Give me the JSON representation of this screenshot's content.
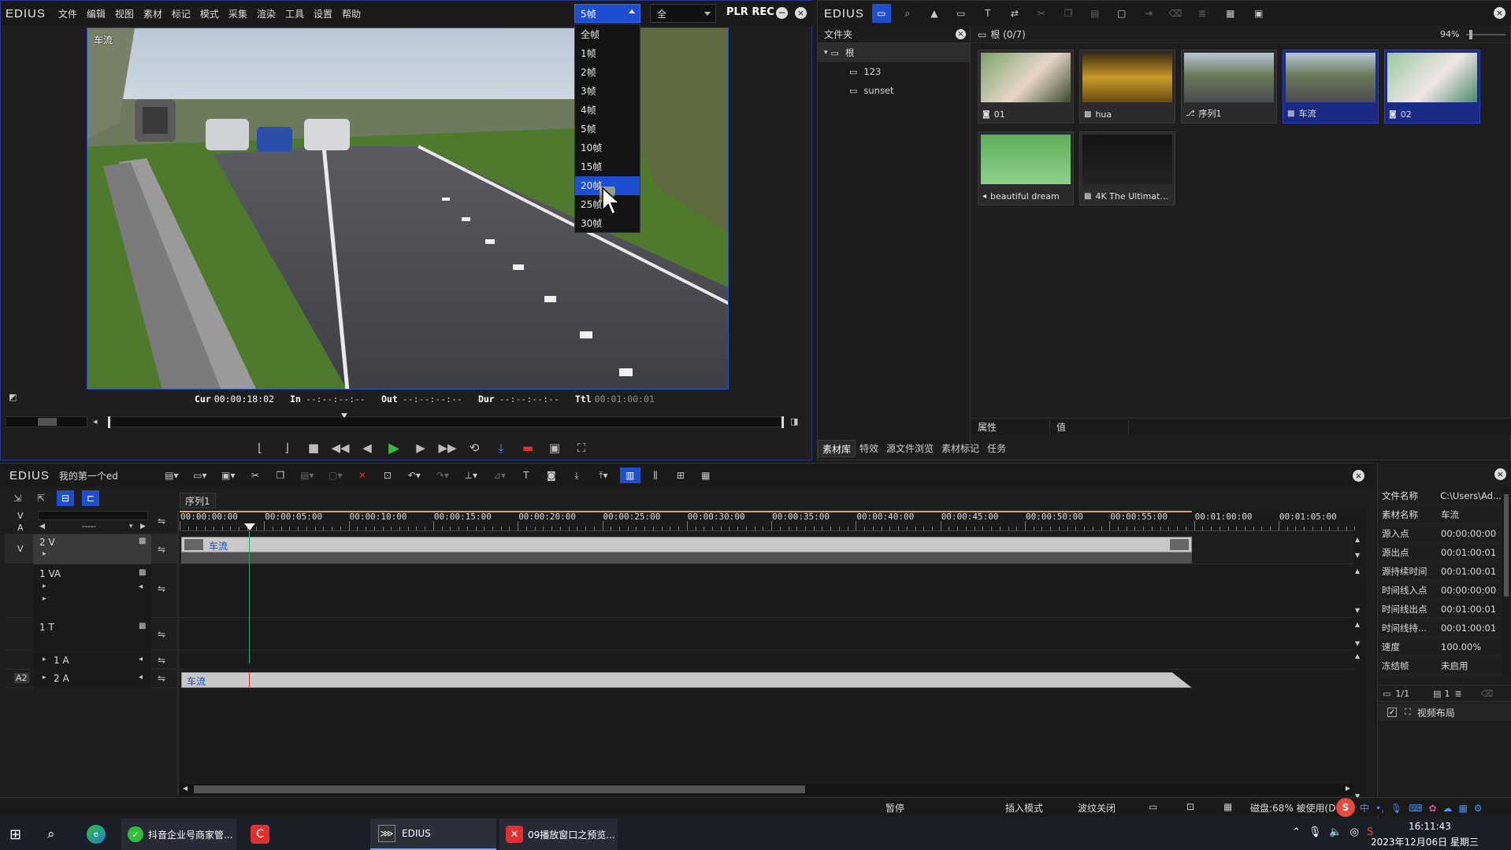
{
  "player": {
    "logo": "EDIUS",
    "menu": [
      "文件",
      "编辑",
      "视图",
      "素材",
      "标记",
      "模式",
      "采集",
      "渲染",
      "工具",
      "设置",
      "帮助"
    ],
    "step_select": "5帧",
    "quality_select": "全",
    "plr_rec": "PLR REC",
    "overlay_label": "车流",
    "dropdown_items": [
      "全帧",
      "1帧",
      "2帧",
      "3帧",
      "4帧",
      "5帧",
      "10帧",
      "15帧",
      "20帧",
      "25帧",
      "30帧"
    ],
    "dropdown_highlight_index": 8,
    "cur_label": "Cur",
    "cur_value": "00:00:18:02",
    "in_label": "In",
    "in_value": "--:--:--:--",
    "out_label": "Out",
    "out_value": "--:--:--:--",
    "dur_label": "Dur",
    "dur_value": "--:--:--:--",
    "ttl_label": "Ttl",
    "ttl_value": "00:01:00:01",
    "scrub_position": 0.35
  },
  "bin": {
    "logo": "EDIUS",
    "folder_header": "文件夹",
    "tree": [
      {
        "label": "根",
        "level": 0
      },
      {
        "label": "123",
        "level": 1
      },
      {
        "label": "sunset",
        "level": 1
      }
    ],
    "path": "根 (0/7)",
    "zoom": "94%",
    "clips": [
      {
        "label": "01",
        "kind": "image",
        "selected": false
      },
      {
        "label": "hua",
        "kind": "video",
        "selected": false
      },
      {
        "label": "序列1",
        "kind": "sequence",
        "selected": false
      },
      {
        "label": "车流",
        "kind": "video",
        "selected": true
      },
      {
        "label": "02",
        "kind": "image",
        "selected": true
      },
      {
        "label": "beautiful dream",
        "kind": "audio",
        "selected": false
      },
      {
        "label": "4K The Ultimat...",
        "kind": "video",
        "selected": false
      }
    ],
    "prop_col": "属性",
    "val_col": "值",
    "tabs": [
      "素材库",
      "特效",
      "源文件浏览",
      "素材标记",
      "任务"
    ]
  },
  "timeline": {
    "logo": "EDIUS",
    "project": "我的第一个ed",
    "sequence_tab": "序列1",
    "ruler": [
      "00:00:00:00",
      "00:00:05:00",
      "00:00:10:00",
      "00:00:15:00",
      "00:00:20:00",
      "00:00:25:00",
      "00:00:30:00",
      "00:00:35:00",
      "00:00:40:00",
      "00:00:45:00",
      "00:00:50:00",
      "00:00:55:00",
      "00:01:00:00",
      "00:01:05:00"
    ],
    "va_header_v": "V",
    "va_header_a": "A",
    "va_dash": "-----",
    "tracks": {
      "t2v": {
        "side": "V",
        "name": "2 V"
      },
      "t1va": {
        "name": "1 VA"
      },
      "t1t": {
        "name": "1 T"
      },
      "t1a": {
        "name": "1 A"
      },
      "t2a": {
        "side": "A2",
        "name": "2 A"
      }
    },
    "clip_video": "车流",
    "clip_audio": "车流"
  },
  "info": {
    "rows": [
      {
        "k": "文件名称",
        "v": "C:\\Users\\Ad..."
      },
      {
        "k": "素材名称",
        "v": "车流"
      },
      {
        "k": "源入点",
        "v": "00:00:00:00"
      },
      {
        "k": "源出点",
        "v": "00:01:00:01"
      },
      {
        "k": "源持续时间",
        "v": "00:01:00:01"
      },
      {
        "k": "时间线入点",
        "v": "00:00:00:00"
      },
      {
        "k": "时间线出点",
        "v": "00:01:00:01"
      },
      {
        "k": "时间线持...",
        "v": "00:01:00:01"
      },
      {
        "k": "速度",
        "v": "100.00%"
      },
      {
        "k": "冻结帧",
        "v": "未启用"
      }
    ],
    "page": "1/1",
    "layer_count": "1",
    "effect": "视频布局"
  },
  "status": {
    "pause": "暂停",
    "insert_mode": "插入模式",
    "ripple": "波纹关闭",
    "disk": "磁盘:68% 被使用(D"
  },
  "taskbar": {
    "apps": [
      "抖音企业号商家管...",
      "EDIUS",
      "09播放窗口之预览..."
    ],
    "time": "16:11:43",
    "date": "2023年12月06日 星期三",
    "ime": "中"
  },
  "colors": {
    "accent": "#1f4fd1",
    "selected": "#1a2a85",
    "play": "#2fbf3a",
    "stop_red": "#e03030"
  }
}
